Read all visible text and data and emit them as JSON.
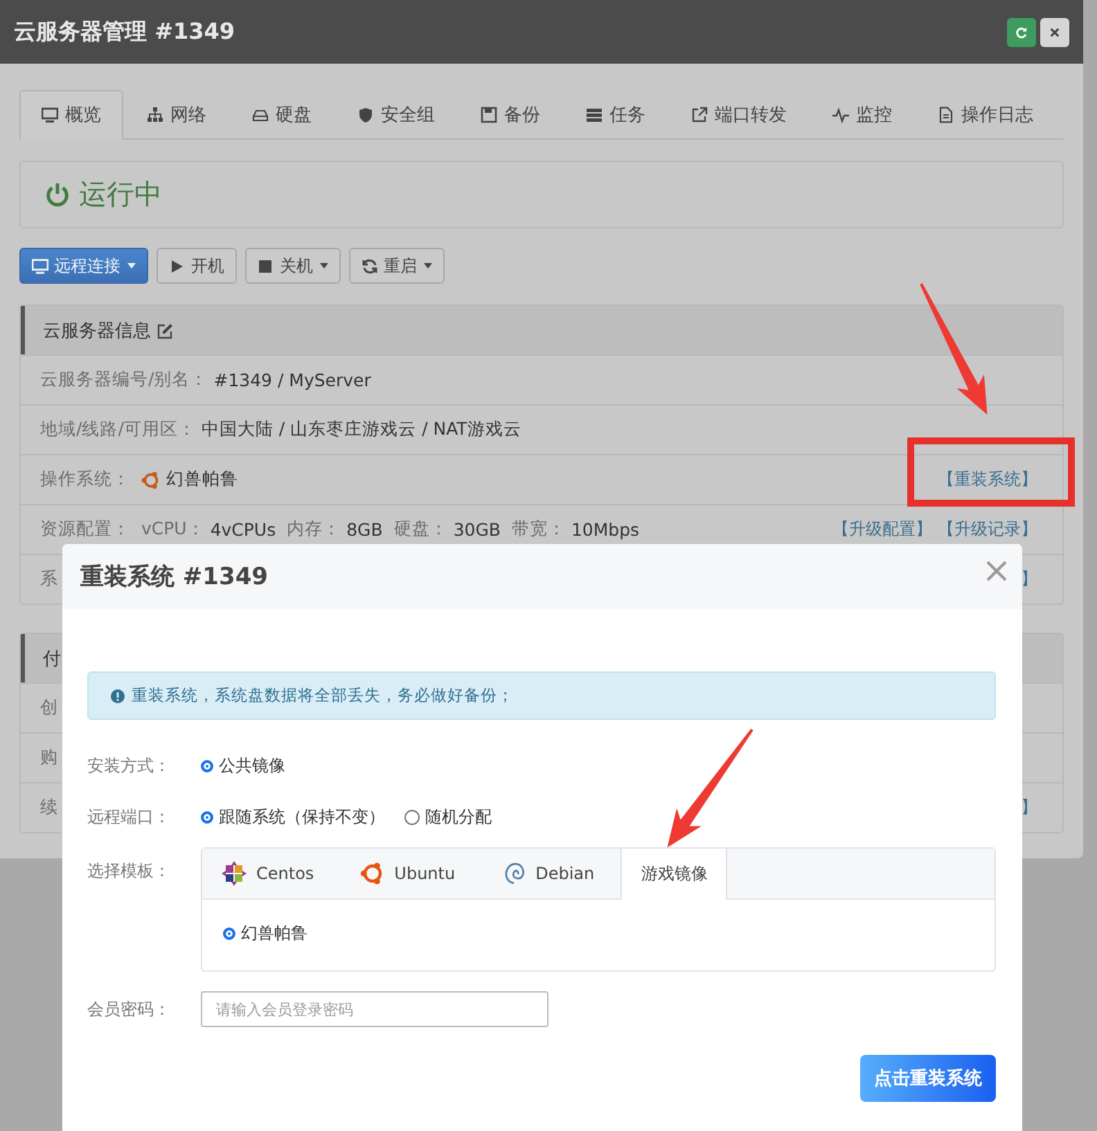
{
  "window": {
    "title": "云服务器管理 #1349"
  },
  "tabs": [
    {
      "label": "概览",
      "kind": "monitor",
      "selected": true
    },
    {
      "label": "网络",
      "kind": "network",
      "selected": false
    },
    {
      "label": "硬盘",
      "kind": "disk",
      "selected": false
    },
    {
      "label": "安全组",
      "kind": "shield",
      "selected": false
    },
    {
      "label": "备份",
      "kind": "save",
      "selected": false
    },
    {
      "label": "任务",
      "kind": "tasks",
      "selected": false
    },
    {
      "label": "端口转发",
      "kind": "external",
      "selected": false
    },
    {
      "label": "监控",
      "kind": "pulse",
      "selected": false
    },
    {
      "label": "操作日志",
      "kind": "file",
      "selected": false
    }
  ],
  "status": {
    "label": "运行中",
    "running": true
  },
  "actions": [
    {
      "label": "远程连接",
      "kind": "monitor",
      "primary": true,
      "dropdown": true
    },
    {
      "label": "开机",
      "kind": "play",
      "primary": false,
      "dropdown": false
    },
    {
      "label": "关机",
      "kind": "stop",
      "primary": false,
      "dropdown": true
    },
    {
      "label": "重启",
      "kind": "refresh",
      "primary": false,
      "dropdown": true
    }
  ],
  "info_panel": {
    "title": "云服务器信息",
    "rows": [
      {
        "label": "云服务器编号/别名：",
        "parts": [
          {
            "value": "#1349 / MyServer"
          }
        ]
      },
      {
        "label": "地域/线路/可用区：",
        "parts": [
          {
            "value": "中国大陆 / 山东枣庄游戏云 / NAT游戏云"
          }
        ]
      },
      {
        "label": "操作系统：",
        "kind": "ubuntu",
        "parts": [
          {
            "value": "幻兽帕鲁"
          }
        ],
        "links": [
          "【重装系统】"
        ]
      },
      {
        "label": "资源配置：",
        "parts": [
          {
            "key": "vCPU：",
            "value": "4vCPUs"
          },
          {
            "key": "内存：",
            "value": "8GB"
          },
          {
            "key": "硬盘：",
            "value": "30GB"
          },
          {
            "key": "带宽：",
            "value": "10Mbps"
          }
        ],
        "links": [
          "【升级配置】",
          "【升级记录】"
        ]
      },
      {
        "label": "系",
        "links": [
          "】"
        ]
      }
    ]
  },
  "billing_panel": {
    "title": "付",
    "rows": [
      {
        "label": "创"
      },
      {
        "label": "购"
      },
      {
        "label": "续",
        "links": [
          "】"
        ]
      }
    ]
  },
  "modal": {
    "title": "重装系统 #1349",
    "alert": "重装系统，系统盘数据将全部丢失，务必做好备份；",
    "install_method": {
      "label": "安装方式：",
      "options": [
        {
          "label": "公共镜像",
          "selected": true
        }
      ]
    },
    "remote_port": {
      "label": "远程端口：",
      "options": [
        {
          "label": "跟随系统（保持不变）",
          "selected": true
        },
        {
          "label": "随机分配",
          "selected": false
        }
      ]
    },
    "template": {
      "label": "选择模板：",
      "tabs": [
        {
          "label": "Centos",
          "kind": "centos",
          "selected": false
        },
        {
          "label": "Ubuntu",
          "kind": "ubuntu",
          "selected": false
        },
        {
          "label": "Debian",
          "kind": "debian",
          "selected": false
        },
        {
          "label": "游戏镜像",
          "kind": "none",
          "selected": true
        }
      ],
      "options": [
        {
          "label": "幻兽帕鲁",
          "selected": true
        }
      ]
    },
    "password": {
      "label": "会员密码：",
      "placeholder": "请输入会员登录密码"
    },
    "submit": "点击重装系统"
  }
}
